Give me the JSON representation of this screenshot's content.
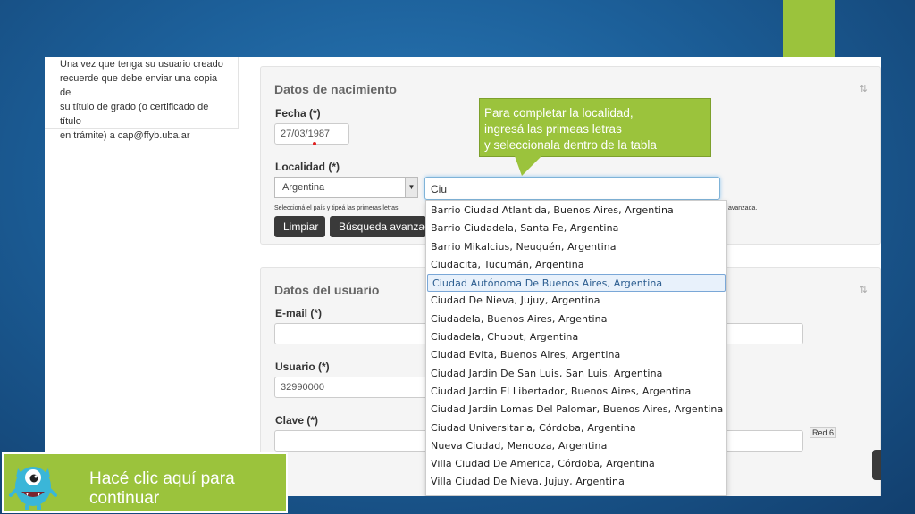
{
  "info_box": {
    "lines": [
      "Una vez que tenga su usuario creado",
      "recuerde que debe enviar una copia de",
      "su título de grado (o certificado de título",
      "en trámite) a cap@ffyb.uba.ar"
    ]
  },
  "section_birth": {
    "title": "Datos de nacimiento",
    "date_label": "Fecha (*)",
    "date_value": "27/03/1987",
    "locality_label": "Localidad (*)",
    "country_value": "Argentina",
    "search_value": "Ciu",
    "hint_left": "Seleccioná el país y tipeá las primeras letras",
    "hint_right": "avanzada."
  },
  "buttons": {
    "clear": "Limpiar",
    "advanced": "Búsqueda avanzada"
  },
  "dropdown": {
    "items": [
      "Barrio Ciudad Atlantida, Buenos Aires, Argentina",
      "Barrio Ciudadela, Santa Fe, Argentina",
      "Barrio Mikalcius, Neuquén, Argentina",
      "Ciudacita, Tucumán, Argentina",
      "Ciudad Autónoma De Buenos Aires, Argentina",
      "Ciudad De Nieva, Jujuy, Argentina",
      "Ciudadela, Buenos Aires, Argentina",
      "Ciudadela, Chubut, Argentina",
      "Ciudad Evita, Buenos Aires, Argentina",
      "Ciudad Jardin De San Luis, San Luis, Argentina",
      "Ciudad Jardin El Libertador, Buenos Aires, Argentina",
      "Ciudad Jardin Lomas Del Palomar, Buenos Aires, Argentina",
      "Ciudad Universitaria, Córdoba, Argentina",
      "Nueva Ciudad, Mendoza, Argentina",
      "Villa Ciudad De America, Córdoba, Argentina",
      "Villa Ciudad De Nieva, Jujuy, Argentina"
    ],
    "selected_index": 4
  },
  "section_user": {
    "title": "Datos del usuario",
    "email_label": "E-mail (*)",
    "user_label": "Usuario (*)",
    "user_value": "32990000",
    "password_label": "Clave (*)"
  },
  "callout": {
    "lines": [
      "Para completar la localidad,",
      "ingresá las  primeas letras",
      "y seleccionala dentro de la tabla"
    ]
  },
  "continue": {
    "text": "Hacé clic aquí para continuar"
  },
  "footer_label": "Red 6",
  "colors": {
    "accent_green": "#9bc33c",
    "background_blue": "#1c5f99"
  }
}
